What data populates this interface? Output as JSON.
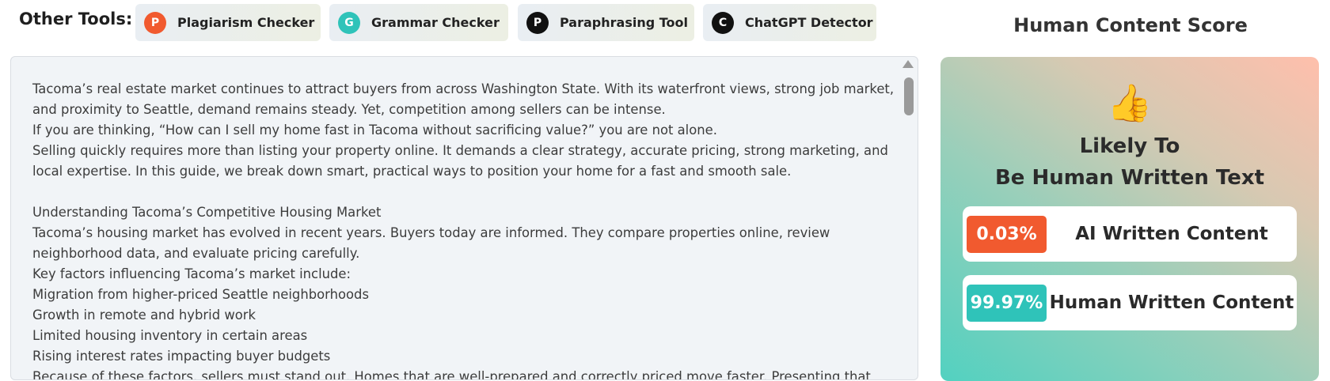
{
  "other_tools": {
    "label": "Other Tools:",
    "tools": [
      {
        "name": "Plagiarism Checker",
        "icon_letter": "P",
        "icon_color": "#f15a2f"
      },
      {
        "name": "Grammar Checker",
        "icon_letter": "G",
        "icon_color": "#2fc3b9"
      },
      {
        "name": "Paraphrasing Tool",
        "icon_letter": "P",
        "icon_color": "#111111"
      },
      {
        "name": "ChatGPT Detector",
        "icon_letter": "C",
        "icon_color": "#111111"
      }
    ]
  },
  "editor": {
    "lines": [
      "Tacoma’s real estate market continues to attract buyers from across Washington State. With its waterfront views, strong job market,",
      "and proximity to Seattle, demand remains steady. Yet, competition among sellers can be intense.",
      "If you are thinking, “How can I sell my home fast in Tacoma without sacrificing value?” you are not alone.",
      "Selling quickly requires more than listing your property online. It demands a clear strategy, accurate pricing, strong marketing, and",
      "local expertise. In this guide, we break down smart, practical ways to position your home for a fast and smooth sale.",
      "",
      "Understanding Tacoma’s Competitive Housing Market",
      "Tacoma’s housing market has evolved in recent years. Buyers today are informed. They compare properties online, review",
      "neighborhood data, and evaluate pricing carefully.",
      "Key factors influencing Tacoma’s market include:",
      "Migration from higher-priced Seattle neighborhoods",
      "Growth in remote and hybrid work",
      "Limited housing inventory in certain areas",
      "Rising interest rates impacting buyer budgets",
      "Because of these factors, sellers must stand out. Homes that are well-prepared and correctly priced move faster. Presenting that"
    ]
  },
  "score": {
    "title": "Human Content Score",
    "icon": "thumbs-up-icon",
    "verdict_line1": "Likely To",
    "verdict_line2": "Be Human Written Text",
    "ai": {
      "percent": "0.03%",
      "label": "AI Written Content",
      "color": "#f15a2f"
    },
    "human": {
      "percent": "99.97%",
      "label": "Human Written Content",
      "color": "#2fc3b9"
    }
  }
}
